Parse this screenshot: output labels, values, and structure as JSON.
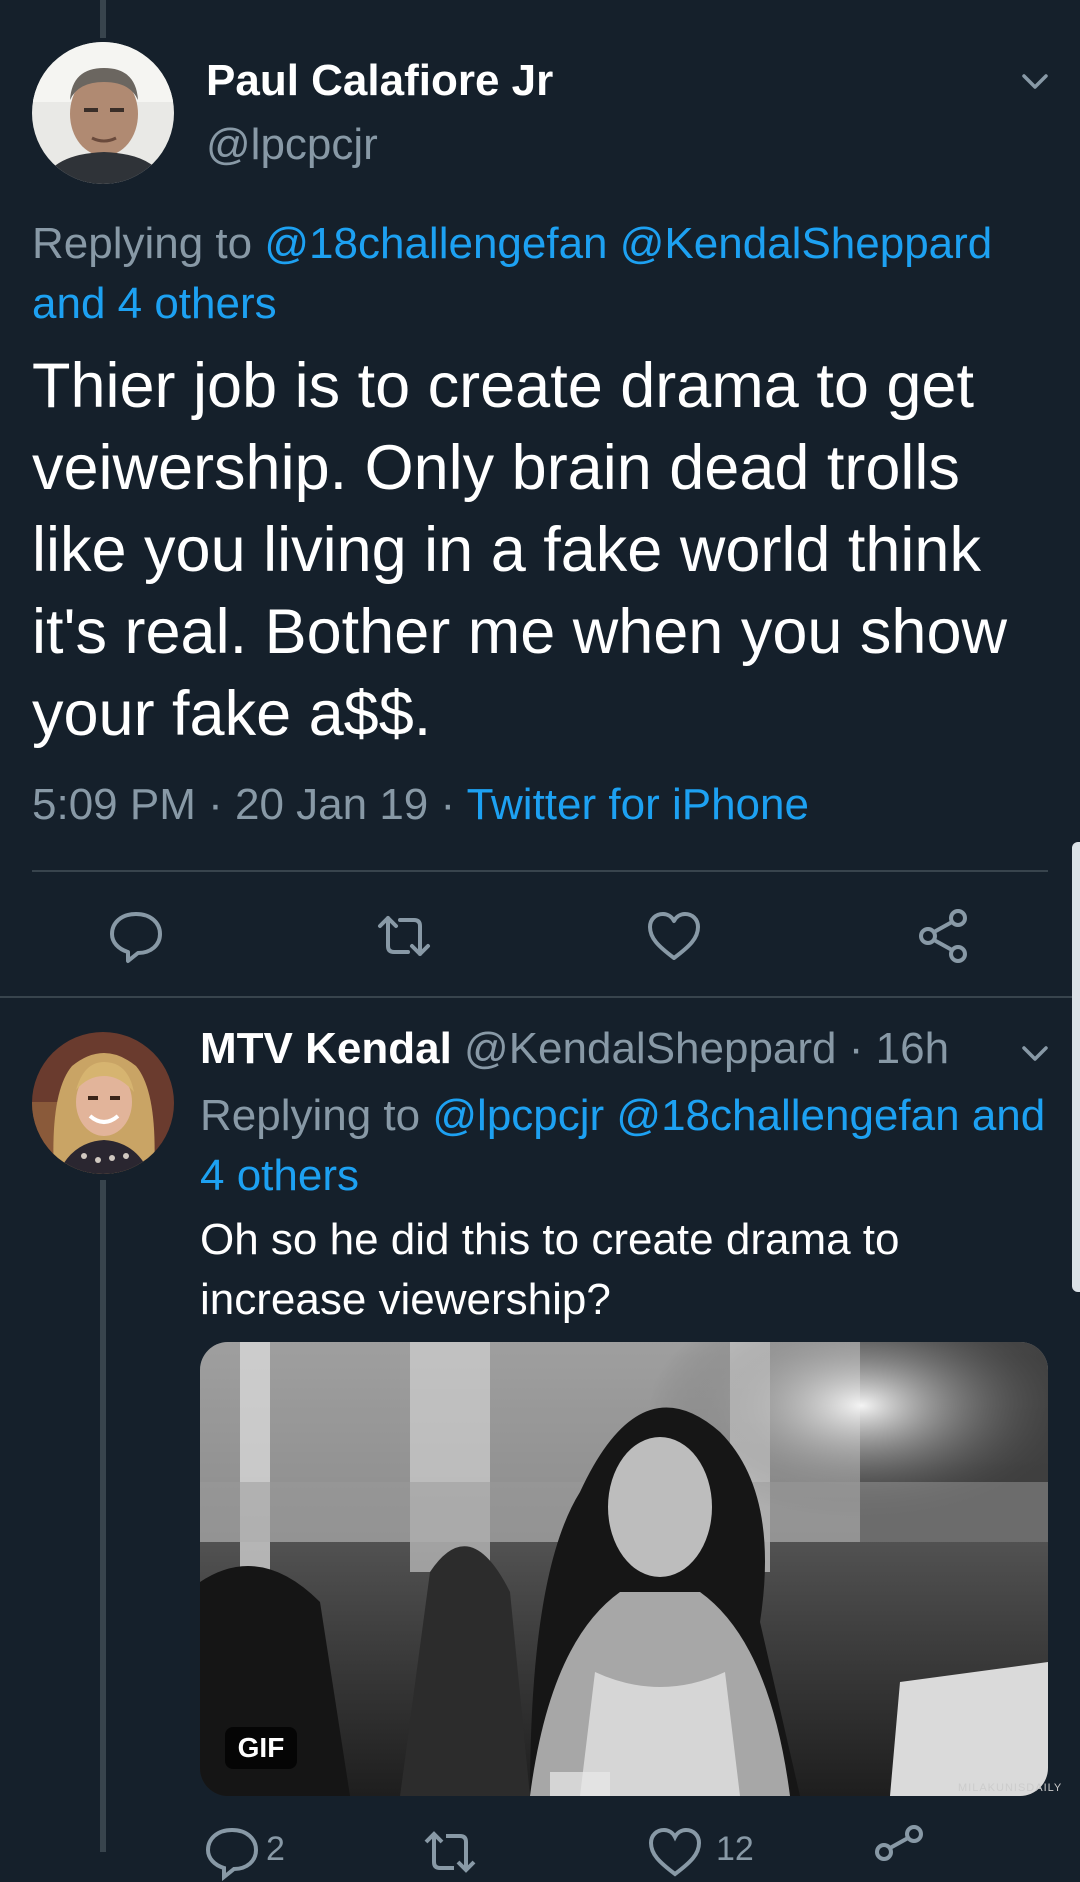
{
  "tweet": {
    "author_name": "Paul Calafiore Jr",
    "author_handle": "@lpcpcjr",
    "replying_label": "Replying to",
    "replying_handle_1": "@18challengefan",
    "replying_handle_2": "@KendalSheppard",
    "replying_others": "and 4 others",
    "text": "Thier job is to create drama to get veiwership. Only brain dead trolls like you living in a fake world think it's real. Bother me when you show your fake a$$.",
    "time": "5:09 PM",
    "date": "20 Jan 19",
    "separator": " · ",
    "source": "Twitter for iPhone",
    "actions": {
      "reply_icon": "reply-icon",
      "retweet_icon": "retweet-icon",
      "like_icon": "heart-icon",
      "share_icon": "share-icon"
    }
  },
  "reply": {
    "author_name": "MTV Kendal",
    "author_handle": "@KendalSheppard",
    "age": "16h",
    "replying_label": "Replying to",
    "replying_handle_1": "@lpcpcjr",
    "replying_handle_2": "@18challengefan",
    "replying_others": "and 4 others",
    "text": "Oh so he did this to create drama to increase viewership?",
    "media_badge": "GIF",
    "media_watermark": "MILAKUNISDAILY",
    "reply_count": "2",
    "like_count": "12"
  },
  "colors": {
    "background": "#15202b",
    "accent": "#1da1f2",
    "secondary_text": "#8899a6",
    "divider": "#38444d"
  }
}
